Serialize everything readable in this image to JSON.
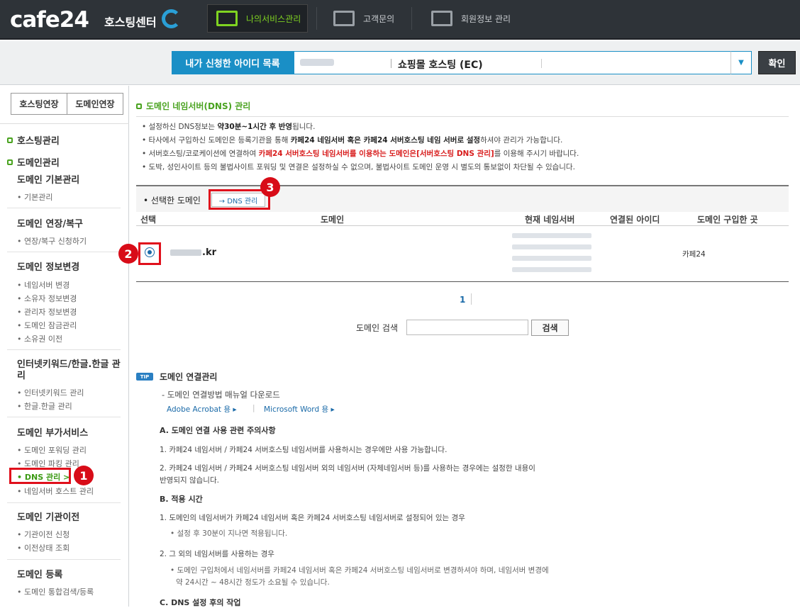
{
  "header": {
    "logo": "cafe24",
    "logo_sub": "호스팅센터",
    "nav": [
      {
        "label": "나의서비스관리",
        "icon": "server-gear-icon",
        "active": true
      },
      {
        "label": "고객문의",
        "icon": "monitor-phone-icon",
        "active": false
      },
      {
        "label": "회원정보 관리",
        "icon": "monitor-user-icon",
        "active": false
      }
    ]
  },
  "id_selector": {
    "label": "내가 신청한 아이디 목록",
    "selected_service": "쇼핑몰 호스팅 (EC)",
    "confirm_label": "확인"
  },
  "sidebar": {
    "btn_hosting": "호스팅연장",
    "btn_domain": "도메인연장",
    "cat_hosting": "호스팅관리",
    "cat_domain": "도메인관리",
    "groups": [
      {
        "title": "도메인 기본관리",
        "items": [
          "기본관리"
        ]
      },
      {
        "title": "도메인 연장/복구",
        "items": [
          "연장/복구 신청하기"
        ]
      },
      {
        "title": "도메인 정보변경",
        "items": [
          "네임서버 변경",
          "소유자 정보변경",
          "관리자 정보변경",
          "도메인 잠금관리",
          "소유권 이전"
        ]
      },
      {
        "title": "인터넷키워드/한글.한글 관리",
        "items": [
          "인터넷키워드 관리",
          "한글.한글 관리"
        ]
      },
      {
        "title": "도메인 부가서비스",
        "items": [
          "도메인 포워딩 관리",
          "도메인 파킹 관리",
          "DNS 관리 >",
          "네임서버 호스트 관리"
        ]
      },
      {
        "title": "도메인 기관이전",
        "items": [
          "기관이전 신청",
          "이전상태 조회"
        ]
      },
      {
        "title": "도메인 등록",
        "items": [
          "도메인 통합검색/등록"
        ]
      }
    ]
  },
  "main": {
    "title": "도메인 네임서버(DNS) 관리",
    "notes": [
      {
        "pre": "설정하신 DNS정보는 ",
        "bold": "약30분~1시간 후 반영",
        "post": "됩니다."
      },
      {
        "pre": "타사에서 구입하신 도메인은 등록기관을 통해 ",
        "bold": "카페24 네임서버 혹은 카페24 서버호스팅 네임 서버로 설정",
        "post": "하셔야 관리가 가능합니다."
      },
      {
        "pre": "서버호스팅/코로케이션에 연결하여 ",
        "bold": "카페24 서버호스팅 네임서버를 이용하는 도메인은[서버호스팅 DNS 관리]",
        "post": "를 이용해 주시기 바랍니다."
      },
      {
        "pre": "도박, 성인사이트 등의 불법사이트 포워딩 및 연결은 설정하실 수 없으며, 불법사이트 도메인 운영 시 별도의 통보없이 차단될 수 있습니다.",
        "bold": "",
        "post": ""
      }
    ],
    "selected_domain_label": "선택한 도메인",
    "dns_button": "→ DNS 관리",
    "table": {
      "headers": [
        "선택",
        "도메인",
        "현재 네임서버",
        "연결된 아이디",
        "도메인 구입한 곳"
      ],
      "row": {
        "domain": ".kr",
        "registrar": "카페24"
      }
    },
    "pagination": "1",
    "search_label": "도메인 검색",
    "search_button": "검색",
    "tip": {
      "badge": "TIP",
      "title": "도메인 연결관리",
      "manual": "- 도메인 연결방법 매뉴얼 다운로드",
      "link1": "Adobe Acrobat 용 ▸",
      "link_sep": "|",
      "link2": "Microsoft Word 용 ▸",
      "secA": "A. 도메인 연결 사용 관련 주의사항",
      "a1": "1. 카페24 네임서버 / 카페24 서버호스팅 네임서버를 사용하시는 경우에만 사용 가능합니다.",
      "a2_1": "2. 카페24 네임서버 / 카페24 서버호스팅 네임서버 외의 네임서버 (자체네임서버 등)를 사용하는 경우에는 설정한 내용이",
      "a2_2": "반영되지 않습니다.",
      "secB": "B. 적용 시간",
      "b1": "1. 도메인의 네임서버가 카페24 네임서버 혹은 카페24 서버호스팅 네임서버로 설정되어 있는 경우",
      "b1_sub": "• 설정 후 30분이 지나면 적용됩니다.",
      "b2": "2. 그 외의 네임서버를 사용하는 경우",
      "b2_sub1": "• 도메인 구입처에서 네임서버를 카페24 네임서버 혹은 카페24 서버호스팅 네임서버로 변경하셔야 하며, 네임서버 변경에",
      "b2_sub2": "약 24시간 ~ 48시간 정도가 소요될 수 있습니다.",
      "secC": "C. DNS 설정 후의 작업"
    }
  },
  "markers": [
    "1",
    "2",
    "3"
  ]
}
